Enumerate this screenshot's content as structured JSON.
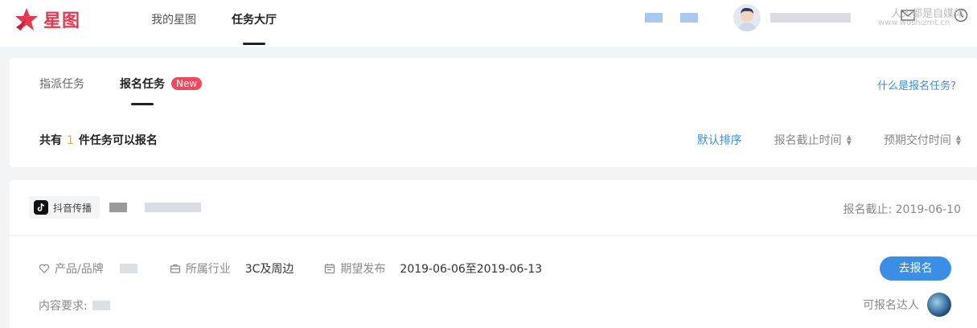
{
  "header": {
    "logo_text": "星图",
    "nav": [
      "我的星图",
      "任务大厅"
    ],
    "watermark": "人人都是自媒体",
    "watermark_url": "www.woshizmt.cn"
  },
  "tabs": {
    "items": [
      "指派任务",
      "报名任务"
    ],
    "new_badge": "New",
    "help_link": "什么是报名任务?"
  },
  "summary": {
    "prefix": "共有",
    "count": "1",
    "suffix": "件任务可以报名"
  },
  "sort": [
    "默认排序",
    "报名截止时间",
    "预期交付时间"
  ],
  "task": {
    "platform": "抖音传播",
    "deadline": "报名截止: 2019-06-10",
    "product_label": "产品/品牌",
    "industry_label": "所属行业",
    "industry_value": "3C及周边",
    "publish_label": "期望发布",
    "publish_value": "2019-06-06至2019-06-13",
    "signup_button": "去报名",
    "content_label": "内容要求:",
    "talent_label": "可报名达人"
  },
  "colors": {
    "brand": "#e8384f",
    "accent": "#3a8ee6",
    "badge": "#f0495d",
    "count": "#f5a623"
  }
}
